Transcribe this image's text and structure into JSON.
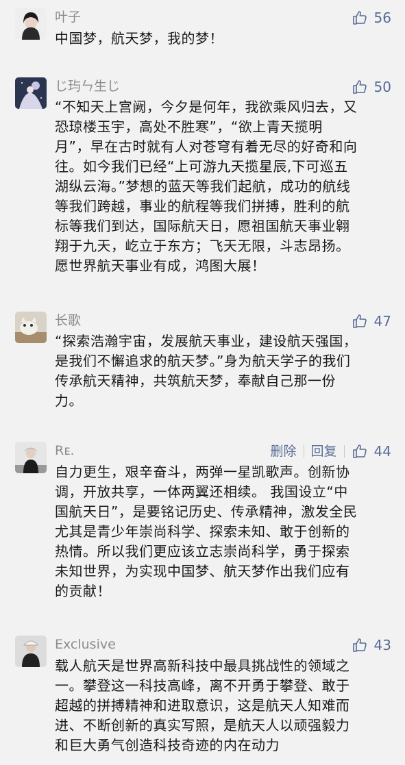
{
  "comments": [
    {
      "name": "叶子",
      "likes": "56",
      "lines": [
        "中国梦，航天梦，我的梦！"
      ]
    },
    {
      "name": "じ玙ㄣ生じ",
      "likes": "50",
      "lines": [
        "“不知天上宫阙，今夕是何年，我欲乘风归去，又",
        "恐琼楼玉宇，高处不胜寒”，“欲上青天揽明",
        "月”，早在古时就有人对苍穹有着无尽的好奇和向",
        "往。如今我们已经“上可游九天揽星辰,下可巡五",
        "湖纵云海。”梦想的蓝天等我们起航，成功的航线",
        "等我们跨越，事业的航程等我们拼搏，胜利的航",
        "标等我们到达，国际航天日，愿祖国航天事业翱",
        "翔于九天，屹立于东方；飞天无限，斗志昂扬。",
        "愿世界航天事业有成，鸿图大展！"
      ]
    },
    {
      "name": "长歌",
      "likes": "47",
      "lines": [
        "“探索浩瀚宇宙，发展航天事业，建设航天强国，",
        "是我们不懈追求的航天梦。”身为航天学子的我们",
        "传承航天精神，共筑航天梦，奉献自己那一份",
        "力。"
      ]
    },
    {
      "name": "Rᴇ.",
      "likes": "44",
      "delete_label": "删除",
      "reply_label": "回复",
      "lines": [
        "自力更生，艰辛奋斗，两弹一星凯歌声。创新协",
        "调，开放共享，一体两翼还相续。 我国设立“中",
        "国航天日”，是要铭记历史、传承精神，激发全民",
        "尤其是青少年崇尚科学、探索未知、敢于创新的",
        "热情。所以我们更应该立志崇尚科学，勇于探索",
        "未知世界，为实现中国梦、航天梦作出我们应有",
        "的贡献！"
      ]
    },
    {
      "name": "Exclusive",
      "likes": "43",
      "lines": [
        "载人航天是世界高新科技中最具挑战性的领域之",
        "一。攀登这一科技高峰，离不开勇于攀登、敢于",
        "超越的拼搏精神和进取意识，这是航天人知难而",
        "进、不断创新的真实写照，是航天人以顽强毅力",
        "和巨大勇气创造科技奇迹的内在动力"
      ]
    }
  ]
}
